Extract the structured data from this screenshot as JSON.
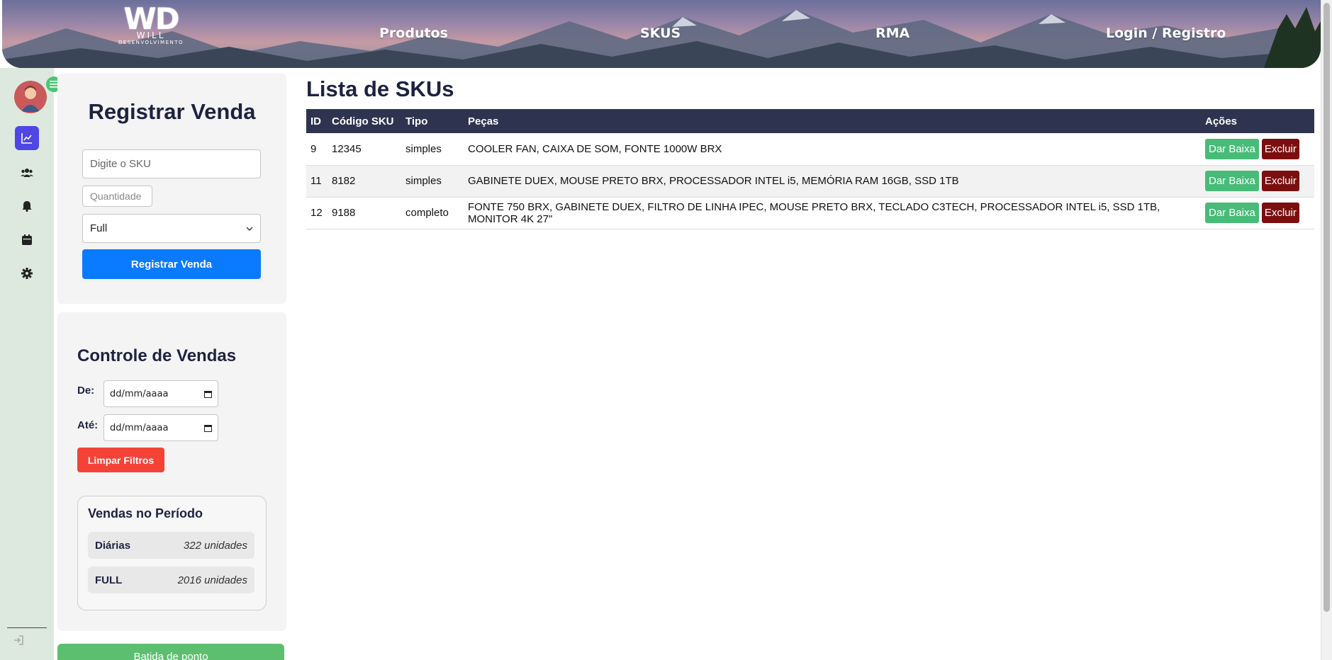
{
  "header": {
    "logo": {
      "initials": "WD",
      "name": "WILL",
      "tagline": "DESENVOLVIMENTO"
    },
    "nav": [
      {
        "label": "Produtos"
      },
      {
        "label": "SKUS"
      },
      {
        "label": "RMA"
      },
      {
        "label": "Login / Registro"
      }
    ]
  },
  "sidebar": {
    "icons": [
      "chart-line-icon",
      "users-icon",
      "bell-icon",
      "calendar-icon",
      "gear-icon"
    ],
    "active_index": 0,
    "accent": "#4f46e5",
    "logout_icon": "sign-in-icon"
  },
  "registrar": {
    "title": "Registrar Venda",
    "sku_placeholder": "Digite o SKU",
    "qty_placeholder": "Quantidade",
    "tipo_selected": "Full",
    "button": "Registrar Venda"
  },
  "controle": {
    "title": "Controle de Vendas",
    "de_label": "De:",
    "ate_label": "Até:",
    "date_placeholder": "dd/mm/aaaa",
    "clear_button": "Limpar Filtros",
    "periodo_title": "Vendas no Período",
    "rows": [
      {
        "label": "Diárias",
        "value": "322 unidades"
      },
      {
        "label": "FULL",
        "value": "2016 unidades"
      }
    ],
    "batida_button": "Batida de ponto"
  },
  "skus": {
    "title": "Lista de SKUs",
    "columns": [
      "ID",
      "Código SKU",
      "Tipo",
      "Peças",
      "Ações"
    ],
    "rows": [
      {
        "id": "9",
        "codigo": "12345",
        "tipo": "simples",
        "pecas": "COOLER FAN, CAIXA DE SOM, FONTE 1000W BRX"
      },
      {
        "id": "11",
        "codigo": "8182",
        "tipo": "simples",
        "pecas": "GABINETE DUEX, MOUSE PRETO BRX, PROCESSADOR INTEL i5, MEMÓRIA RAM 16GB, SSD 1TB"
      },
      {
        "id": "12",
        "codigo": "9188",
        "tipo": "completo",
        "pecas": "FONTE 750 BRX, GABINETE DUEX, FILTRO DE LINHA IPEC, MOUSE PRETO BRX, TECLADO C3TECH, PROCESSADOR INTEL i5, SSD 1TB, MONITOR 4K 27\""
      }
    ],
    "action_baixa": "Dar Baixa",
    "action_excluir": "Excluir"
  },
  "colors": {
    "header_table": "#2e3450",
    "primary": "#0a7bff",
    "danger": "#f44336",
    "success": "#48bb78",
    "excluir": "#7b0f0f"
  }
}
